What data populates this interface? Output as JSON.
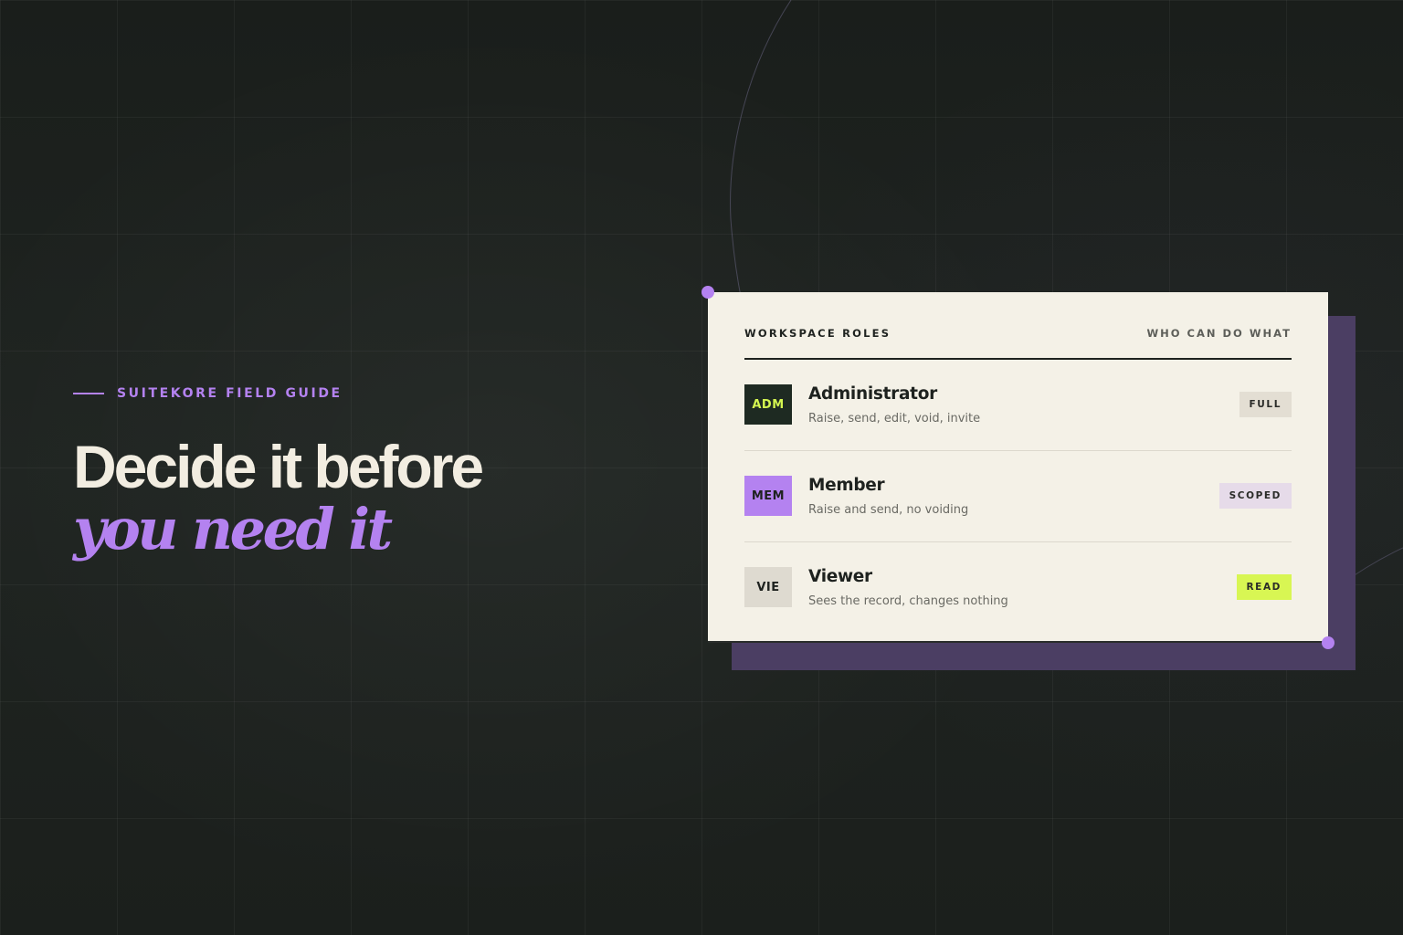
{
  "hero": {
    "eyebrow": "SUITEKORE FIELD GUIDE",
    "headline_line1": "Decide it before",
    "headline_line2": "you need it"
  },
  "card": {
    "title": "WORKSPACE ROLES",
    "subtitle": "WHO CAN DO WHAT",
    "roles": [
      {
        "code": "ADM",
        "name": "Administrator",
        "description": "Raise, send, edit, void, invite",
        "badge": "FULL",
        "code_bg": "#1e2a22",
        "code_color": "#d4f550",
        "badge_bg": "#e3ded3"
      },
      {
        "code": "MEM",
        "name": "Member",
        "description": "Raise and send, no voiding",
        "badge": "SCOPED",
        "code_bg": "#b482f0",
        "code_color": "#1e221f",
        "badge_bg": "#e6dbe9"
      },
      {
        "code": "VIE",
        "name": "Viewer",
        "description": "Sees the record, changes nothing",
        "badge": "READ",
        "code_bg": "#dedad0",
        "code_color": "#1e221f",
        "badge_bg": "#d8f653"
      }
    ]
  },
  "colors": {
    "accent": "#b482f0",
    "background": "#1c211e",
    "card": "#f4f1e7",
    "card_shadow": "#4b3e63",
    "lime": "#d8f653"
  }
}
